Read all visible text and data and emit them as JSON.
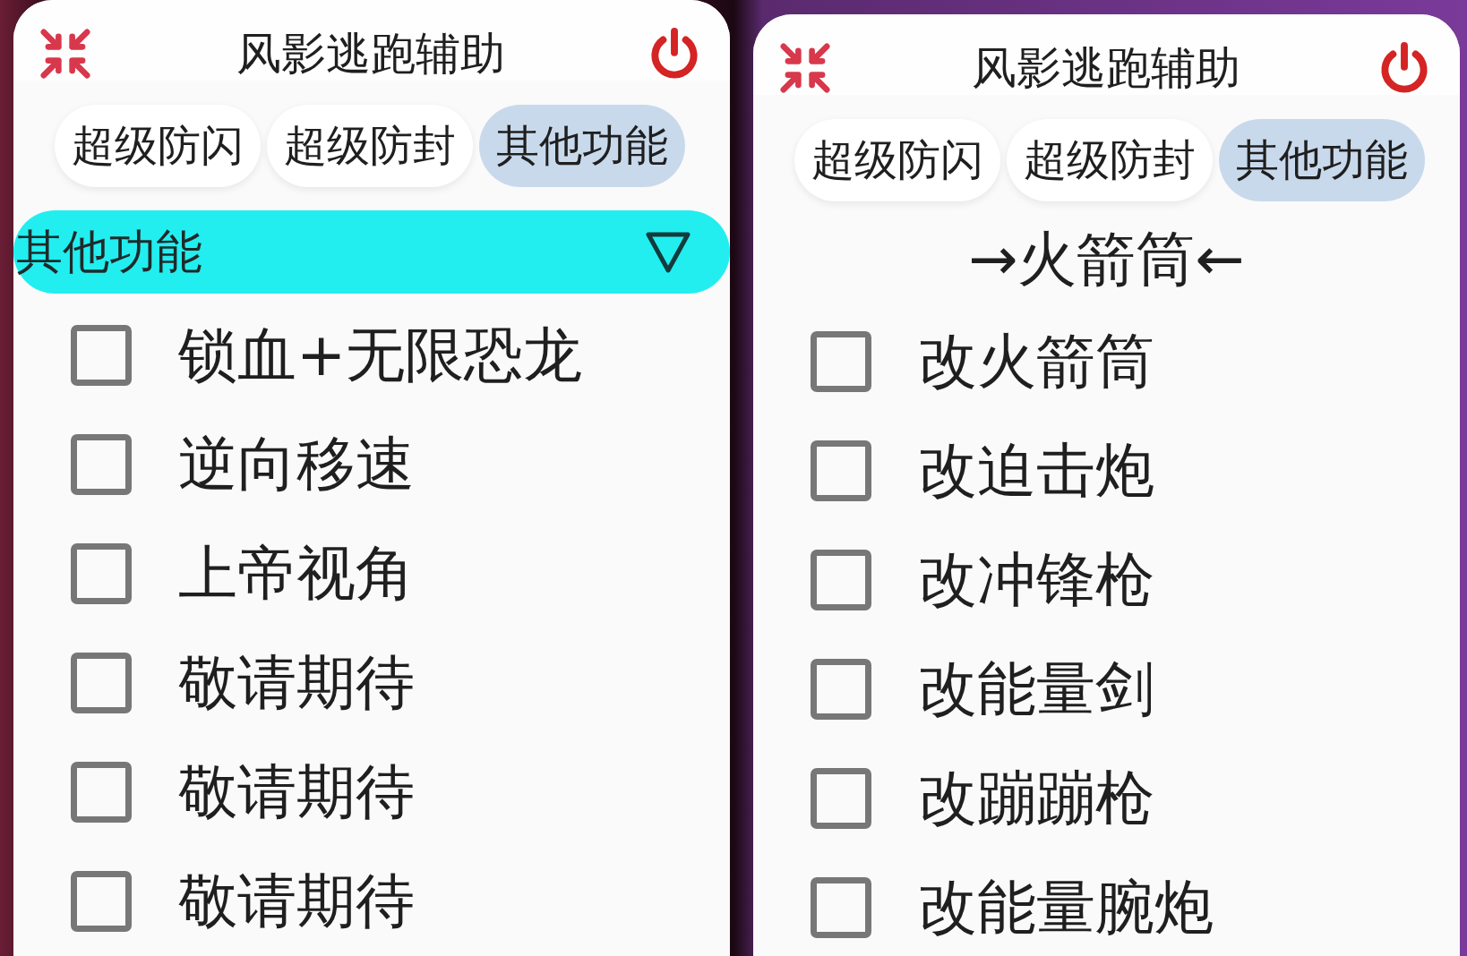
{
  "panels": [
    {
      "title": "风影逃跑辅助",
      "tabs": [
        {
          "label": "超级防闪",
          "selected": false
        },
        {
          "label": "超级防封",
          "selected": false
        },
        {
          "label": "其他功能",
          "selected": true
        }
      ],
      "section": {
        "kind": "dropdown",
        "label": "其他功能"
      },
      "options": [
        {
          "label": "锁血+无限恐龙",
          "checked": false
        },
        {
          "label": "逆向移速",
          "checked": false
        },
        {
          "label": "上帝视角",
          "checked": false
        },
        {
          "label": "敬请期待",
          "checked": false
        },
        {
          "label": "敬请期待",
          "checked": false
        },
        {
          "label": "敬请期待",
          "checked": false
        }
      ]
    },
    {
      "title": "风影逃跑辅助",
      "tabs": [
        {
          "label": "超级防闪",
          "selected": false
        },
        {
          "label": "超级防封",
          "selected": false
        },
        {
          "label": "其他功能",
          "selected": true
        }
      ],
      "section": {
        "kind": "heading",
        "label": "→火箭筒←"
      },
      "options": [
        {
          "label": "改火箭筒",
          "checked": false
        },
        {
          "label": "改迫击炮",
          "checked": false
        },
        {
          "label": "改冲锋枪",
          "checked": false
        },
        {
          "label": "改能量剑",
          "checked": false
        },
        {
          "label": "改蹦蹦枪",
          "checked": false
        },
        {
          "label": "改能量腕炮",
          "checked": false
        }
      ]
    }
  ]
}
